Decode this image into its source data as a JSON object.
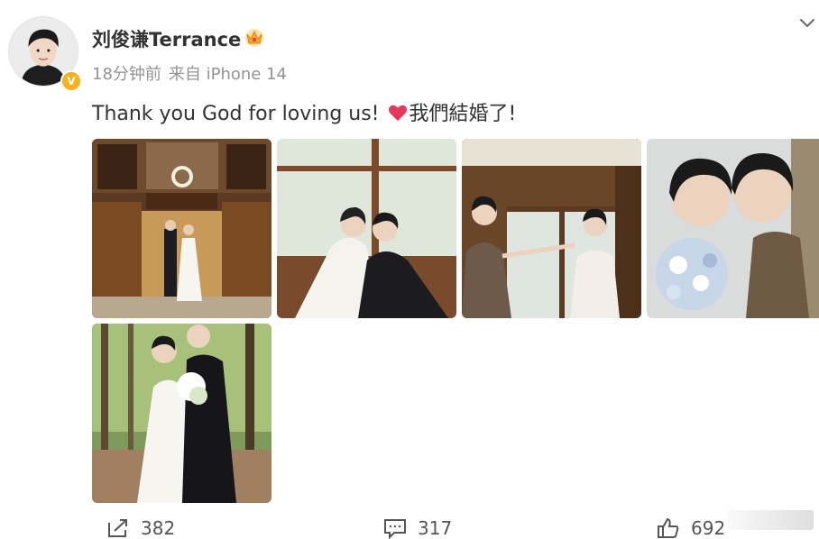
{
  "post": {
    "username": "刘俊谦Terrance",
    "time": "18分钟前",
    "source": "来自 iPhone 14",
    "text_before": "Thank you God for loving us! ",
    "text_after": "我們結婚了!",
    "verified_symbol": "V",
    "badge_icon": "crown-icon",
    "menu_icon": "chevron-down-icon",
    "photo_count": 5
  },
  "actions": {
    "repost_count": "382",
    "comment_count": "317",
    "like_count": "692"
  },
  "colors": {
    "text": "#333333",
    "meta": "#939393",
    "verified": "#f6b21b",
    "heart": "#e8365d"
  }
}
